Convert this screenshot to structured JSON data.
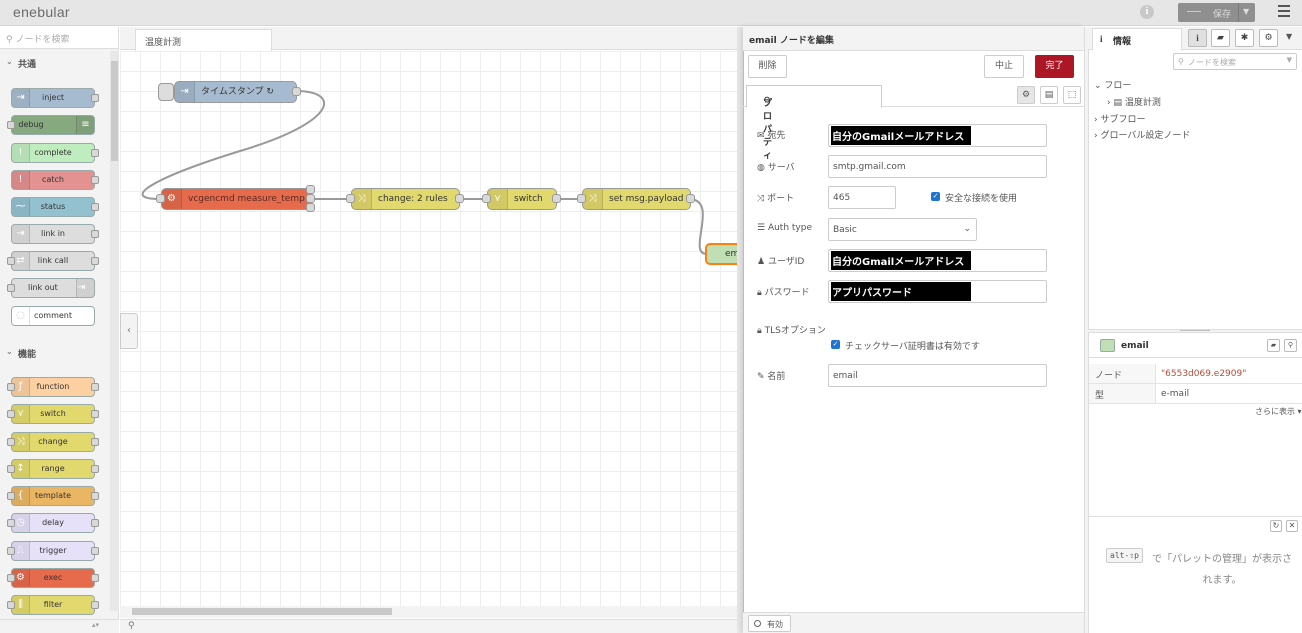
{
  "header": {
    "logo": "enebular",
    "save_label": "保存"
  },
  "palette": {
    "search_placeholder": "ノードを検索",
    "categories": [
      {
        "label": "共通"
      },
      {
        "label": "機能"
      }
    ],
    "nodes": [
      "inject",
      "debug",
      "complete",
      "catch",
      "status",
      "link in",
      "link call",
      "link out",
      "comment",
      "function",
      "switch",
      "change",
      "range",
      "template",
      "delay",
      "trigger",
      "exec",
      "filter"
    ],
    "colors": {
      "inject": "#a6bbcf",
      "debug": "#87a980",
      "complete": "#c0edc0",
      "catch": "#e49191",
      "status": "#94c1d0",
      "link": "#dddddd",
      "comment": "#ffffff",
      "function": "#fdd0a2",
      "switch": "#e2d96e",
      "change": "#e2d96e",
      "range": "#e2d96e",
      "template": "#ebb663",
      "delay": "#e6e0f8",
      "trigger": "#e6e0f8",
      "exec": "#e66b4d",
      "filter": "#e2d96e"
    }
  },
  "workspace": {
    "tab_label": "温度計測",
    "nodes": {
      "inject": "タイムスタンプ ↻",
      "exec": "vcgencmd measure_temp",
      "change": "change: 2 rules",
      "switch": "switch",
      "change2": "set msg.payload",
      "email": "email"
    }
  },
  "editor": {
    "title": "email ノードを編集",
    "delete_label": "削除",
    "cancel_label": "中止",
    "done_label": "完了",
    "tab_properties": "プロパティ",
    "fields": {
      "to": {
        "label": "宛先",
        "value": "自分のGmailメールアドレス"
      },
      "server": {
        "label": "サーバ",
        "value": "smtp.gmail.com"
      },
      "port": {
        "label": "ポート",
        "value": "465",
        "secure_label": "安全な接続を使用"
      },
      "auth_type": {
        "label": "Auth type",
        "value": "Basic"
      },
      "userid": {
        "label": "ユーザID",
        "value": "自分のGmailメールアドレス"
      },
      "password": {
        "label": "パスワード",
        "value": "アプリパスワード"
      },
      "tls": {
        "label": "TLSオプション",
        "checkbox_label": "チェックサーバ証明書は有効です"
      },
      "name": {
        "label": "名前",
        "value": "email"
      }
    },
    "enabled_label": "有効"
  },
  "sidebar": {
    "tab_info": "情報",
    "search_placeholder": "ノードを検索",
    "tree": {
      "flows": "フロー",
      "flow_item": "温度計測",
      "subflows": "サブフロー",
      "global_config": "グローバル設定ノード"
    },
    "node_title": "email",
    "table": [
      {
        "key": "ノード",
        "value": "\"6553d069.e2909\""
      },
      {
        "key": "型",
        "value": "e-mail"
      }
    ],
    "show_more": "さらに表示 ▾",
    "help_kbd": "alt-⇧p",
    "help_text": "で「パレットの管理」が表示されます。"
  }
}
